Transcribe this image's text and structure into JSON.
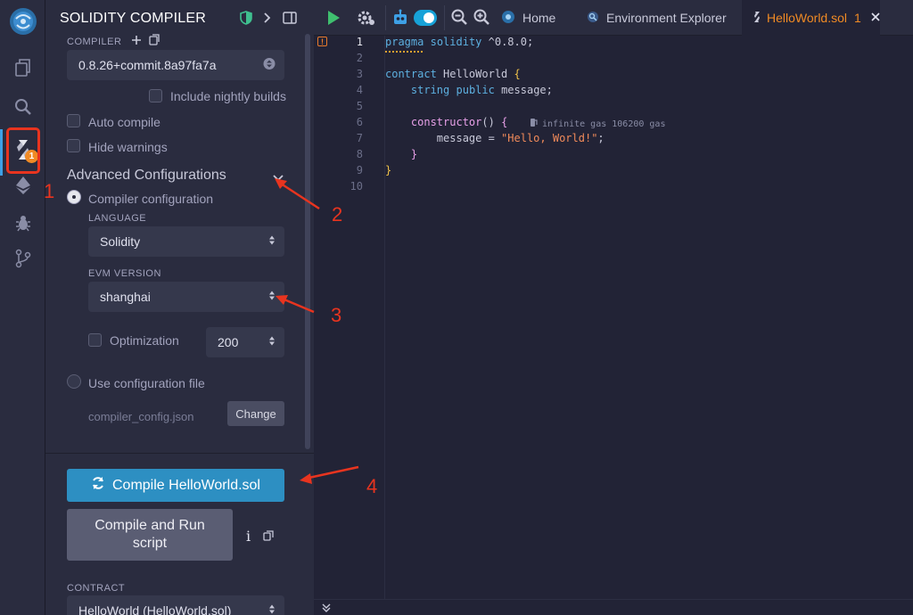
{
  "panel": {
    "title": "SOLIDITY COMPILER",
    "compiler_label": "COMPILER",
    "compiler_version": "0.8.26+commit.8a97fa7a",
    "include_nightly": "Include nightly builds",
    "auto_compile": "Auto compile",
    "hide_warnings": "Hide warnings",
    "advanced_title": "Advanced Configurations",
    "compiler_configuration": "Compiler configuration",
    "language_label": "LANGUAGE",
    "language_value": "Solidity",
    "evm_label": "EVM VERSION",
    "evm_value": "shanghai",
    "optimization_label": "Optimization",
    "optimization_runs": "200",
    "use_config_file": "Use configuration file",
    "config_file_name": "compiler_config.json",
    "change_button": "Change",
    "compile_button": "Compile HelloWorld.sol",
    "run_button": "Compile and Run script",
    "info_glyph": "i",
    "contract_label": "CONTRACT",
    "contract_value": "HelloWorld (HelloWorld.sol)"
  },
  "rail": {
    "badge_count": "1"
  },
  "topbar": {
    "tabs": [
      {
        "label": "Home"
      },
      {
        "label": "Environment Explorer"
      },
      {
        "label": "HelloWorld.sol",
        "badge": "1"
      }
    ]
  },
  "editor": {
    "line_numbers": [
      "1",
      "2",
      "3",
      "4",
      "5",
      "6",
      "7",
      "8",
      "9",
      "10"
    ],
    "gas_hint": "infinite gas 106200 gas"
  },
  "annotations": [
    "1",
    "2",
    "3",
    "4"
  ],
  "colors": {
    "accent": "#2d8fc2",
    "highlight": "#e8341f",
    "active_tab_text": "#f08a24",
    "background": "#222336",
    "panel": "#2a2c3f"
  }
}
